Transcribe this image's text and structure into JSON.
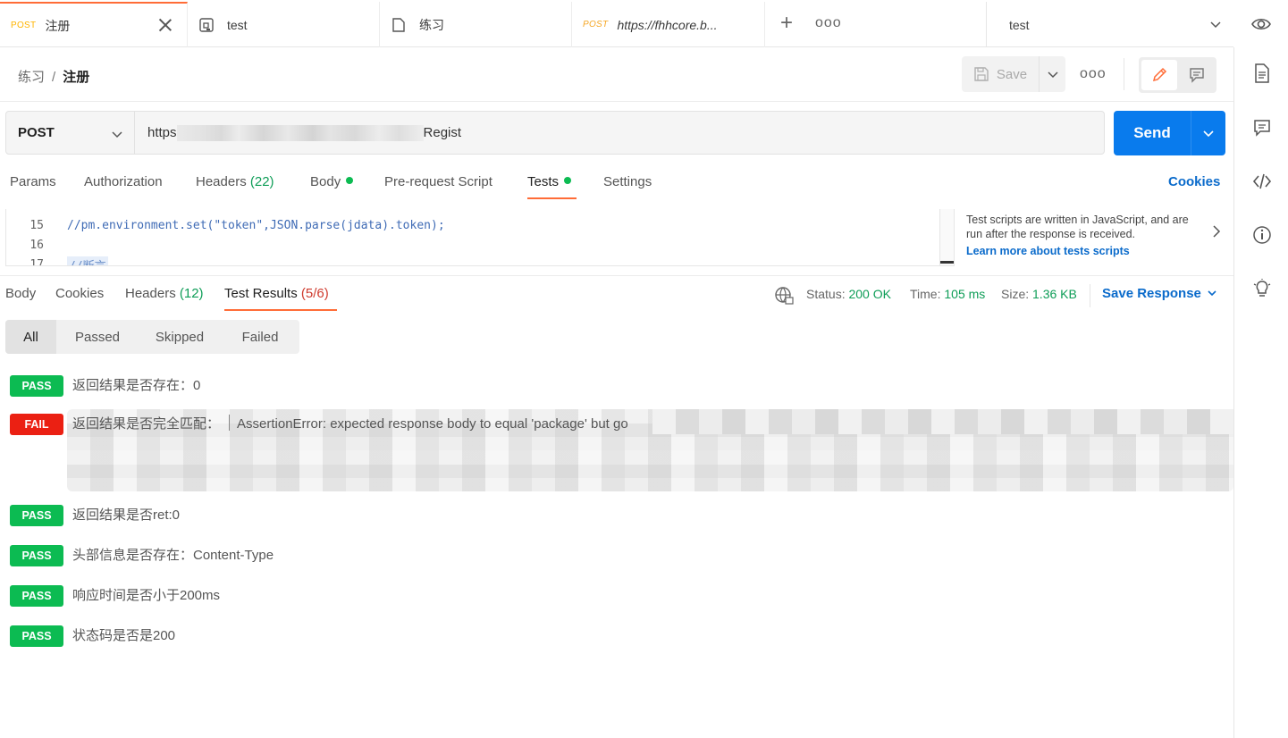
{
  "tabs": [
    {
      "method": "POST",
      "label": "注册",
      "active": true
    },
    {
      "icon": "example-icon",
      "label": "test"
    },
    {
      "icon": "collection-icon",
      "label": "练习"
    },
    {
      "method": "POST",
      "label": "https://fhhcore.b..."
    }
  ],
  "tab_more": "ooo",
  "environment": {
    "selected": "test"
  },
  "breadcrumb": {
    "parent": "练习",
    "separator": "/",
    "current": "注册"
  },
  "toolbar": {
    "save_label": "Save",
    "more": "ooo"
  },
  "request": {
    "method": "POST",
    "url_prefix": "https",
    "url_suffix": "Regist",
    "send_label": "Send"
  },
  "request_tabs": [
    {
      "label": "Params"
    },
    {
      "label": "Authorization"
    },
    {
      "label": "Headers",
      "count": "(22)"
    },
    {
      "label": "Body"
    },
    {
      "label": "Pre-request Script"
    },
    {
      "label": "Tests"
    },
    {
      "label": "Settings"
    }
  ],
  "cookies_link": "Cookies",
  "editor": {
    "lines": [
      {
        "num": "15",
        "code": "//pm.environment.set(\"token\",JSON.parse(jdata).token);"
      },
      {
        "num": "16",
        "code": ""
      },
      {
        "num": "17",
        "code": "//断言"
      }
    ]
  },
  "snippets": {
    "text": "Test scripts are written in JavaScript, and are run after the response is received.",
    "link": "Learn more about tests scripts"
  },
  "response_tabs": [
    {
      "label": "Body"
    },
    {
      "label": "Cookies"
    },
    {
      "label": "Headers",
      "count": "(12)"
    },
    {
      "label": "Test Results",
      "count": "(5/6)"
    }
  ],
  "response_meta": {
    "status_label": "Status:",
    "status_value": "200 OK",
    "time_label": "Time:",
    "time_value": "105 ms",
    "size_label": "Size:",
    "size_value": "1.36 KB",
    "save_response": "Save Response"
  },
  "filters": [
    "All",
    "Passed",
    "Skipped",
    "Failed"
  ],
  "results": [
    {
      "status": "PASS",
      "text": "返回结果是否存在：0"
    },
    {
      "status": "FAIL",
      "text": "返回结果是否完全匹配：",
      "error": "AssertionError: expected response body to equal 'package' but go"
    },
    {
      "status": "PASS",
      "text": "返回结果是否ret:0"
    },
    {
      "status": "PASS",
      "text": "头部信息是否存在：Content-Type"
    },
    {
      "status": "PASS",
      "text": "响应时间是否小于200ms"
    },
    {
      "status": "PASS",
      "text": "状态码是否是200"
    }
  ],
  "colors": {
    "accent": "#ff6c37",
    "send": "#097bed",
    "pass": "#0cbb52",
    "fail": "#eb2013",
    "link": "#0b6bcb"
  }
}
